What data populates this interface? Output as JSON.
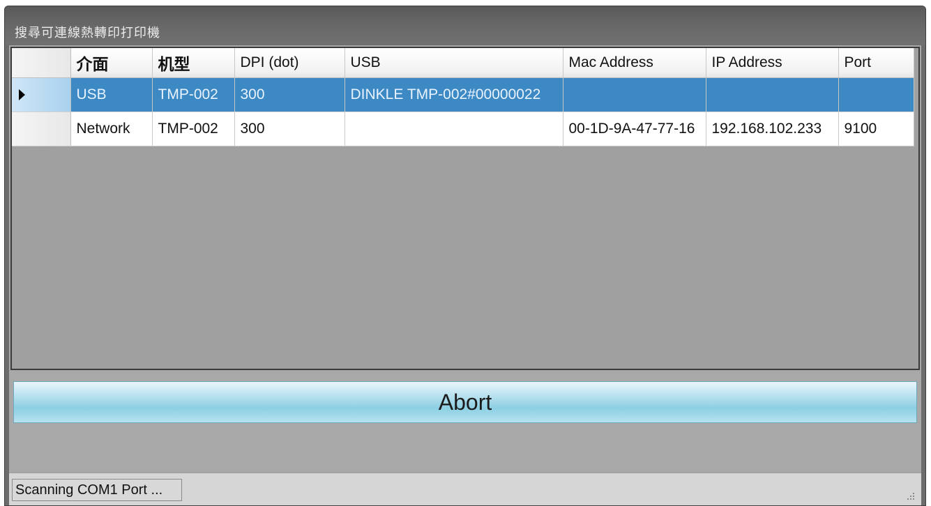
{
  "window": {
    "title": "搜尋可連線熱轉印打印機"
  },
  "grid": {
    "columns": [
      "介面",
      "机型",
      "DPI (dot)",
      "USB",
      "Mac Address",
      "IP Address",
      "Port"
    ],
    "rows": [
      {
        "selected": true,
        "cells": [
          "USB",
          "TMP-002",
          "300",
          "DINKLE TMP-002#00000022",
          "",
          "",
          ""
        ]
      },
      {
        "selected": false,
        "cells": [
          "Network",
          "TMP-002",
          "300",
          "",
          "00-1D-9A-47-77-16",
          "192.168.102.233",
          "9100"
        ]
      }
    ]
  },
  "abort_button": {
    "label": "Abort"
  },
  "status_bar": {
    "text": "Scanning COM1 Port ..."
  },
  "colors": {
    "selection": "#3d89c4",
    "button_accent": "#8ccfe3",
    "window_frame": "#6c6c6c"
  },
  "icons": {
    "row_selector": "current-row-arrow-icon",
    "resize_grip": "resize-grip-icon"
  }
}
